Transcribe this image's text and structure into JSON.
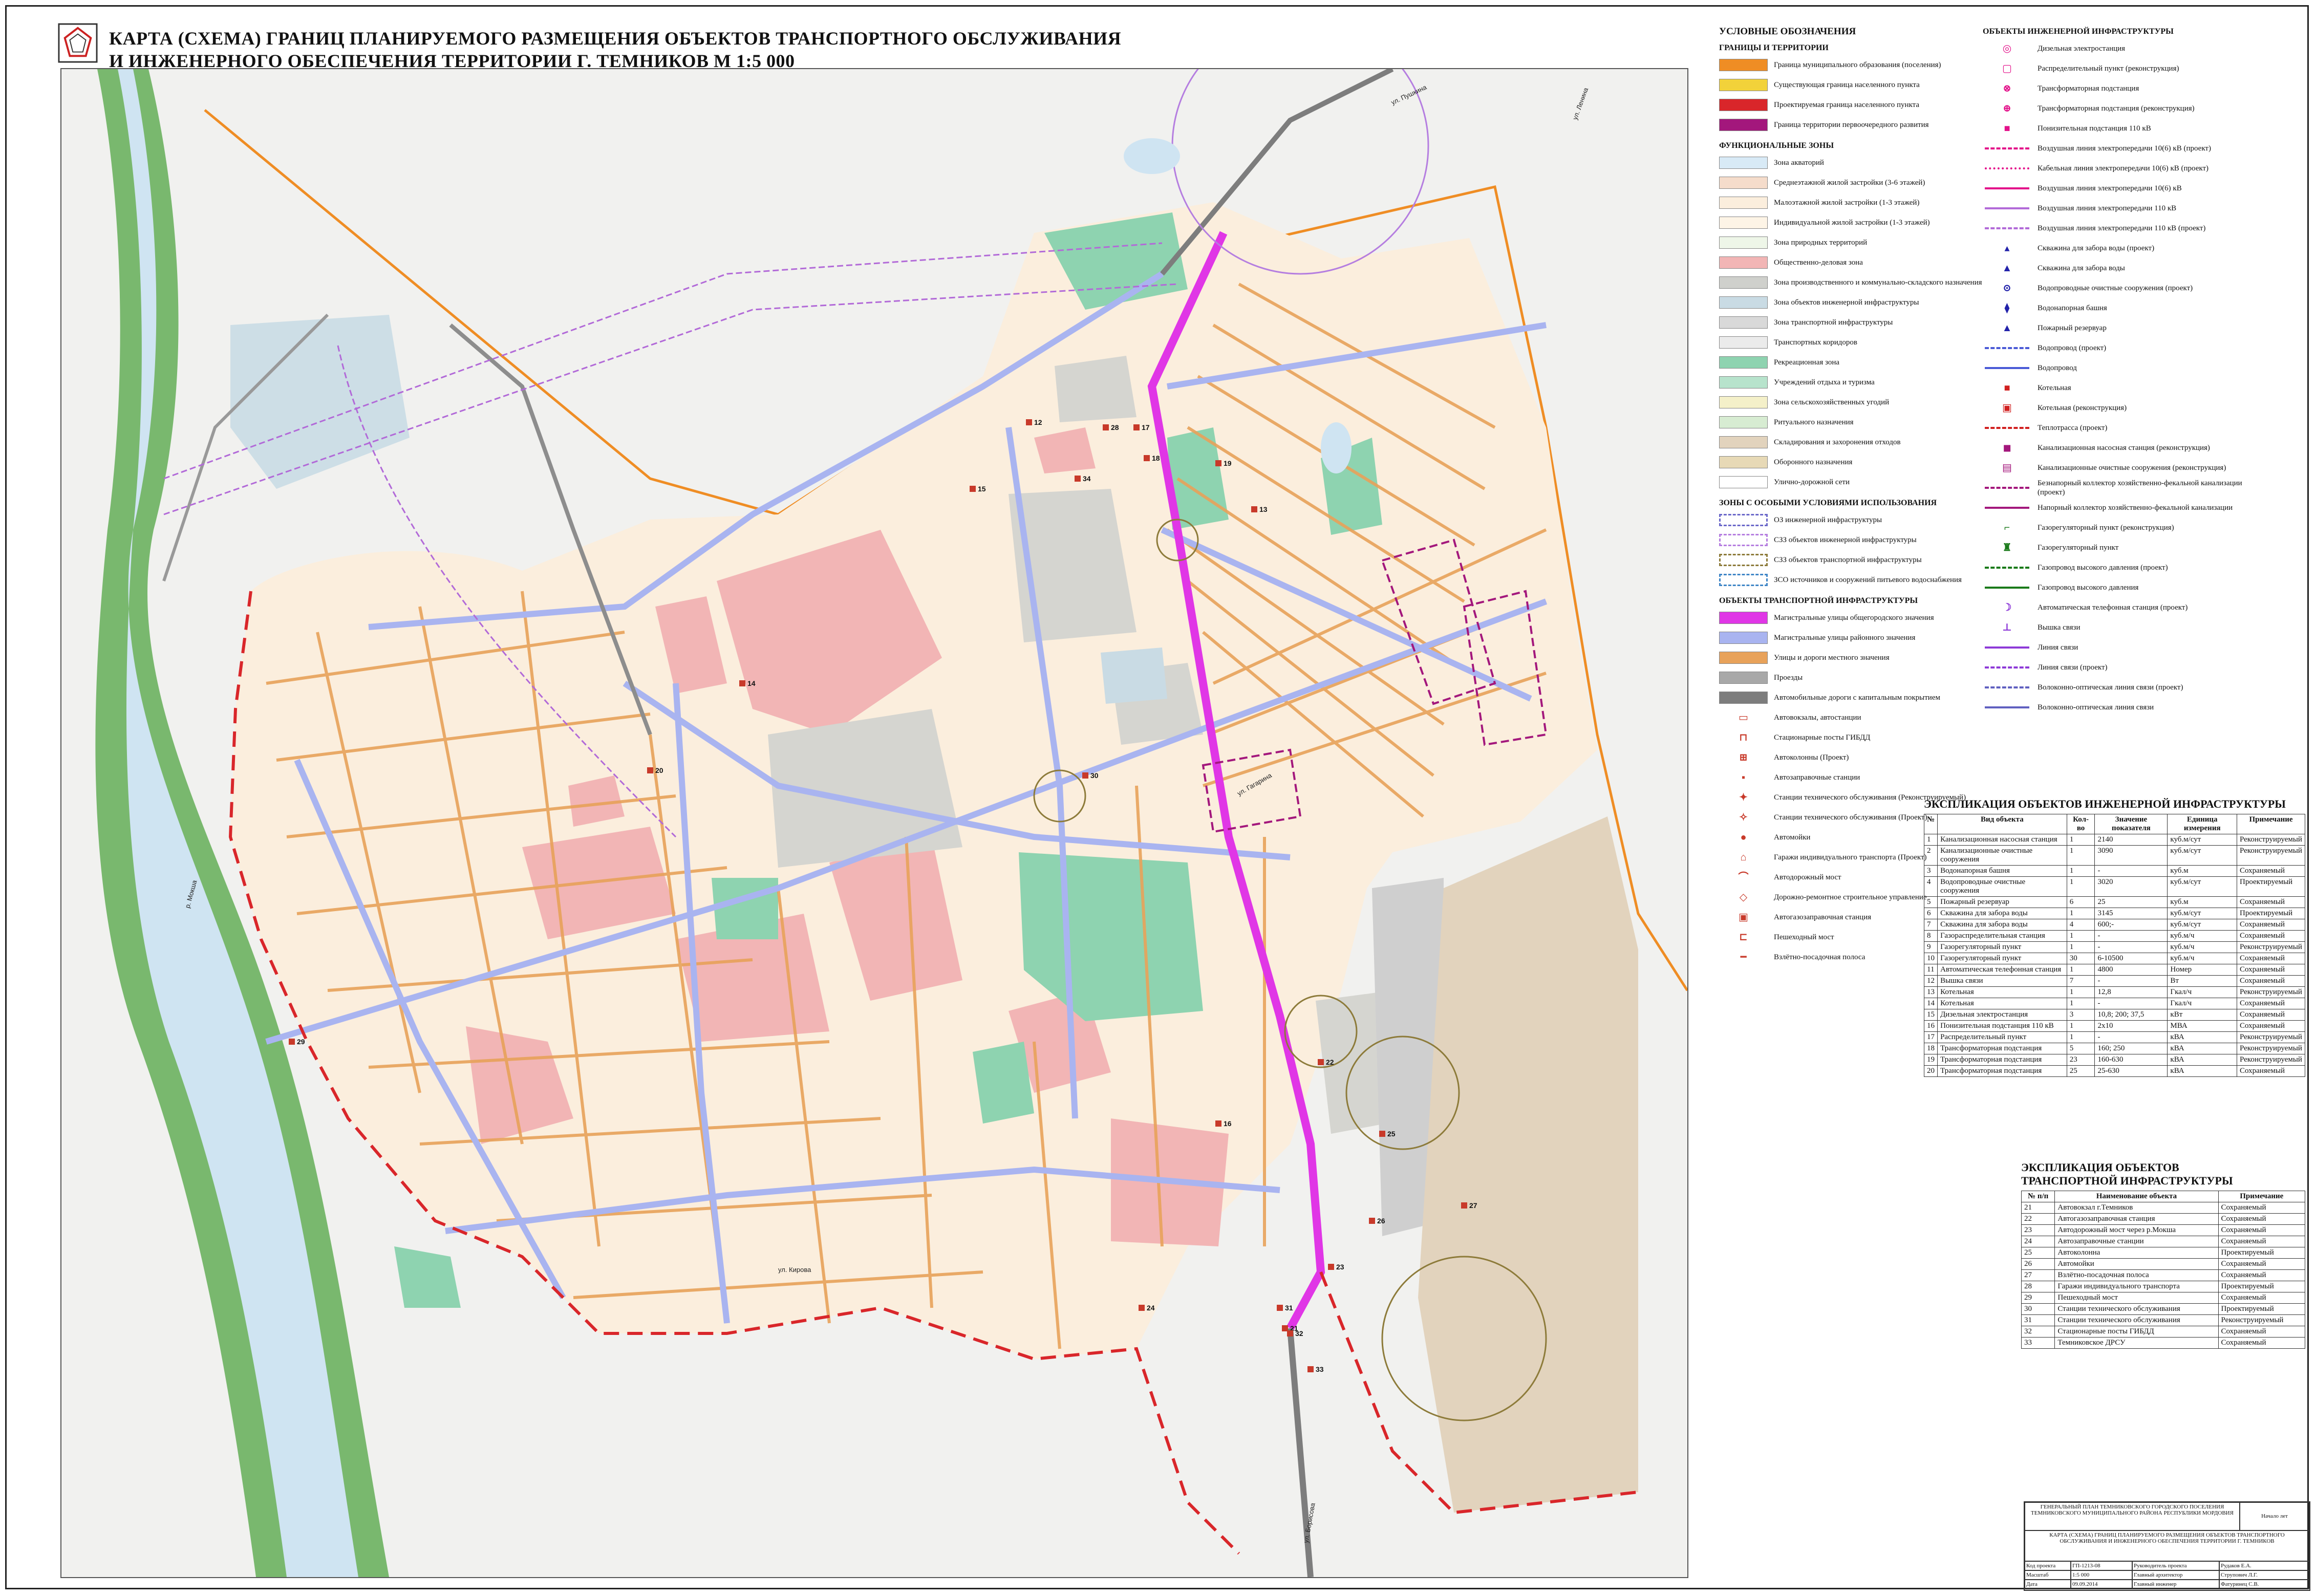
{
  "title": {
    "line1": "КАРТА (СХЕМА)  ГРАНИЦ ПЛАНИРУЕМОГО РАЗМЕЩЕНИЯ ОБЪЕКТОВ ТРАНСПОРТНОГО ОБСЛУЖИВАНИЯ",
    "line2": "И ИНЖЕНЕРНОГО ОБЕСПЕЧЕНИЯ ТЕРРИТОРИИ  Г. ТЕМНИКОВ   М 1:5 000"
  },
  "map": {
    "labels": {
      "river": "р. Мокша",
      "street_top": "ул. Пушкина",
      "street_right": "ул. Ленина",
      "street_bottom": "ул. Борисова",
      "street_btm2": "ул. Кирова",
      "street_mid": "ул. Гагарина"
    },
    "markers": [
      "12",
      "28",
      "17",
      "18",
      "34",
      "15",
      "19",
      "13",
      "22",
      "30",
      "25",
      "27",
      "26",
      "23",
      "21",
      "33",
      "24",
      "29",
      "14",
      "16",
      "20",
      "32",
      "31"
    ],
    "colors": {
      "residential_low": "#fbeedd",
      "residential_mid": "#f5e6dc",
      "public": "#f2b5b5",
      "green": "#8ed3b0",
      "industrial": "#d5d5d0",
      "transport": "#cfcfcf",
      "agri": "#e2d3bd",
      "natural": "#eef6e8",
      "water": "#cfe4f2",
      "water_bank": "#79b86e",
      "main_street": "#e036e6",
      "district_street": "#a9b4f0",
      "local_street": "#e8a25a",
      "boundary_design": "#d9262a",
      "boundary_muni": "#ef8d24"
    }
  },
  "legend": {
    "heading": "УСЛОВНЫЕ ОБОЗНАЧЕНИЯ",
    "boundaries": {
      "title": "ГРАНИЦЫ И ТЕРРИТОРИИ",
      "items": [
        {
          "label": "Граница муниципального образования (поселения)",
          "color": "#ef8d24",
          "kind": "fill"
        },
        {
          "label": "Существующая граница населенного пункта",
          "color": "#f2d23a",
          "kind": "fill"
        },
        {
          "label": "Проектируемая граница населенного пункта",
          "color": "#d9262a",
          "kind": "fill"
        },
        {
          "label": "Граница территории первоочередного развития",
          "color": "#a3177c",
          "kind": "fill"
        }
      ]
    },
    "zones": {
      "title": "ФУНКЦИОНАЛЬНЫЕ ЗОНЫ",
      "items": [
        {
          "label": "Зона акваторий",
          "color": "#d8eaf6"
        },
        {
          "label": "Среднеэтажной жилой застройки (3-6 этажей)",
          "color": "#f5dccb"
        },
        {
          "label": "Малоэтажной жилой застройки (1-3 этажей)",
          "color": "#fbeedd"
        },
        {
          "label": "Индивидуальной жилой застройки (1-3 этажей)",
          "color": "#fdf4e6"
        },
        {
          "label": "Зона природных территорий",
          "color": "#eef6e8"
        },
        {
          "label": "Общественно-деловая зона",
          "color": "#f2b5b5"
        },
        {
          "label": "Зона производственного и коммунально-складского назначения",
          "color": "#cfd0cc"
        },
        {
          "label": "Зона объектов инженерной инфраструктуры",
          "color": "#c9dbe4"
        },
        {
          "label": "Зона транспортной инфраструктуры",
          "color": "#d9d9d9"
        },
        {
          "label": "Транспортных коридоров",
          "color": "#ebebeb"
        },
        {
          "label": "Рекреационная зона",
          "color": "#8ed3b0"
        },
        {
          "label": "Учреждений отдыха и туризма",
          "color": "#b7e3cc"
        },
        {
          "label": "Зона сельскохозяйственных угодий",
          "color": "#f4f0c9"
        },
        {
          "label": "Ритуального назначения",
          "color": "#d7ecd2"
        },
        {
          "label": "Складирования и захоронения отходов",
          "color": "#e2d3bd"
        },
        {
          "label": "Оборонного назначения",
          "color": "#e7d9b6"
        },
        {
          "label": "Улично-дорожной сети",
          "color": "#ffffff"
        }
      ]
    },
    "special": {
      "title": "ЗОНЫ С ОСОБЫМИ УСЛОВИЯМИ ИСПОЛЬЗОВАНИЯ",
      "items": [
        {
          "label": "ОЗ инженерной инфраструктуры",
          "color": "#6b68c9"
        },
        {
          "label": "СЗЗ объектов инженерной инфраструктуры",
          "color": "#b57ee0"
        },
        {
          "label": "СЗЗ объектов транспортной инфраструктуры",
          "color": "#8d7b3a"
        },
        {
          "label": "ЗСО источников и сооружений питьевого водоснабжения",
          "color": "#3f86c7"
        }
      ]
    },
    "transport": {
      "title": "ОБЪЕКТЫ ТРАНСПОРТНОЙ ИНФРАСТРУКТУРЫ",
      "items": [
        {
          "label": "Магистральные улицы общегородского значения",
          "color": "#e036e6",
          "kind": "fill"
        },
        {
          "label": "Магистральные улицы районного значения",
          "color": "#a9b4f0",
          "kind": "fill"
        },
        {
          "label": "Улицы и дороги местного значения",
          "color": "#e8a25a",
          "kind": "fill"
        },
        {
          "label": "Проезды",
          "color": "#a8a8a8",
          "kind": "fill"
        },
        {
          "label": "Автомобильные дороги с капитальным покрытием",
          "color": "#7d7d7d",
          "kind": "fill"
        },
        {
          "label": "Автовокзалы, автостанции",
          "color": "#c83a2a",
          "kind": "sym",
          "glyph": "▭"
        },
        {
          "label": "Стационарные посты ГИБДД",
          "color": "#c83a2a",
          "kind": "sym",
          "glyph": "⊓"
        },
        {
          "label": "Автоколонны (Проект)",
          "color": "#c83a2a",
          "kind": "sym",
          "glyph": "⊞"
        },
        {
          "label": "Автозаправочные станции",
          "color": "#c83a2a",
          "kind": "sym",
          "glyph": "▪"
        },
        {
          "label": "Станции технического обслуживания (Реконструируемый)",
          "color": "#c83a2a",
          "kind": "sym",
          "glyph": "✦"
        },
        {
          "label": "Станции технического обслуживания (Проект)",
          "color": "#c83a2a",
          "kind": "sym",
          "glyph": "✧"
        },
        {
          "label": "Автомойки",
          "color": "#c83a2a",
          "kind": "sym",
          "glyph": "●"
        },
        {
          "label": "Гаражи индивидуального транспорта (Проект)",
          "color": "#c83a2a",
          "kind": "sym",
          "glyph": "⌂"
        },
        {
          "label": "Автодорожный мост",
          "color": "#c83a2a",
          "kind": "sym",
          "glyph": "⌒"
        },
        {
          "label": "Дорожно-ремонтное строительное управление",
          "color": "#c83a2a",
          "kind": "sym",
          "glyph": "◇"
        },
        {
          "label": "Автогазозаправочная станция",
          "color": "#c83a2a",
          "kind": "sym",
          "glyph": "▣"
        },
        {
          "label": "Пешеходный мост",
          "color": "#c83a2a",
          "kind": "sym",
          "glyph": "⊏"
        },
        {
          "label": "Взлётно-посадочная полоса",
          "color": "#c83a2a",
          "kind": "sym",
          "glyph": "━"
        }
      ]
    },
    "engineering": {
      "title": "ОБЪЕКТЫ ИНЖЕНЕРНОЙ ИНФРАСТРУКТУРЫ",
      "items": [
        {
          "label": "Дизельная электростанция",
          "color": "#e3118a",
          "kind": "sym",
          "glyph": "◎"
        },
        {
          "label": "Распределительный пункт (реконструкция)",
          "color": "#e3118a",
          "kind": "sym",
          "glyph": "▢"
        },
        {
          "label": "Трансформаторная подстанция",
          "color": "#e3118a",
          "kind": "sym",
          "glyph": "⊗"
        },
        {
          "label": "Трансформаторная подстанция (реконструкция)",
          "color": "#e3118a",
          "kind": "sym",
          "glyph": "⊕"
        },
        {
          "label": "Понизительная подстанция 110 кВ",
          "color": "#e3118a",
          "kind": "sym",
          "glyph": "■"
        },
        {
          "label": "Воздушная линия электропередачи 10(6) кВ (проект)",
          "color": "#e3118a",
          "kind": "dash"
        },
        {
          "label": "Кабельная линия электропередачи 10(6) кВ (проект)",
          "color": "#e3118a",
          "kind": "dot"
        },
        {
          "label": "Воздушная линия электропередачи 10(6) кВ",
          "color": "#e3118a",
          "kind": "line"
        },
        {
          "label": "Воздушная линия электропередачи 110 кВ",
          "color": "#b26ad8",
          "kind": "line"
        },
        {
          "label": "Воздушная линия электропередачи 110 кВ (проект)",
          "color": "#b26ad8",
          "kind": "dash"
        },
        {
          "label": "Скважина для забора воды (проект)",
          "color": "#2222aa",
          "kind": "sym",
          "glyph": "▴"
        },
        {
          "label": "Скважина для забора воды",
          "color": "#2222aa",
          "kind": "sym",
          "glyph": "▲"
        },
        {
          "label": "Водопроводные очистные сооружения (проект)",
          "color": "#2222aa",
          "kind": "sym",
          "glyph": "⊙"
        },
        {
          "label": "Водонапорная башня",
          "color": "#2222aa",
          "kind": "sym",
          "glyph": "⧫"
        },
        {
          "label": "Пожарный резервуар",
          "color": "#2222aa",
          "kind": "sym",
          "glyph": "▲"
        },
        {
          "label": "Водопровод (проект)",
          "color": "#4a5ad6",
          "kind": "dash"
        },
        {
          "label": "Водопровод",
          "color": "#4a5ad6",
          "kind": "line"
        },
        {
          "label": "Котельная",
          "color": "#d12020",
          "kind": "sym",
          "glyph": "■"
        },
        {
          "label": "Котельная  (реконструкция)",
          "color": "#d12020",
          "kind": "sym",
          "glyph": "▣"
        },
        {
          "label": "Теплотрасса  (проект)",
          "color": "#d12020",
          "kind": "dash"
        },
        {
          "label": "Канализационная насосная станция (реконструкция)",
          "color": "#a3177c",
          "kind": "sym",
          "glyph": "◼"
        },
        {
          "label": "Канализационные очистные сооружения (реконструкция)",
          "color": "#a3177c",
          "kind": "sym",
          "glyph": "▤"
        },
        {
          "label": "Безнапорный коллектор хозяйственно-фекальной канализации (проект)",
          "color": "#a3177c",
          "kind": "dash"
        },
        {
          "label": "Напорный коллектор хозяйственно-фекальной канализации",
          "color": "#a3177c",
          "kind": "line"
        },
        {
          "label": "Газорегуляторный пункт (реконструкция)",
          "color": "#1a7a1a",
          "kind": "sym",
          "glyph": "⌐"
        },
        {
          "label": "Газорегуляторный пункт",
          "color": "#1a7a1a",
          "kind": "sym",
          "glyph": "♜"
        },
        {
          "label": "Газопровод высокого давления (проект)",
          "color": "#1a7a1a",
          "kind": "dash"
        },
        {
          "label": "Газопровод высокого давления",
          "color": "#1a7a1a",
          "kind": "line"
        },
        {
          "label": "Автоматическая телефонная станция (проект)",
          "color": "#8d3ad8",
          "kind": "sym",
          "glyph": "☽"
        },
        {
          "label": "Вышка связи",
          "color": "#8d3ad8",
          "kind": "sym",
          "glyph": "⊥"
        },
        {
          "label": "Линия связи",
          "color": "#8d3ad8",
          "kind": "line"
        },
        {
          "label": "Линия связи (проект)",
          "color": "#8d3ad8",
          "kind": "dash"
        },
        {
          "label": "Волоконно-оптическая линия связи (проект)",
          "color": "#6060c0",
          "kind": "dash"
        },
        {
          "label": "Волоконно-оптическая линия связи",
          "color": "#6060c0",
          "kind": "line"
        }
      ]
    }
  },
  "eng_table": {
    "title": "ЭКСПЛИКАЦИЯ ОБЪЕКТОВ ИНЖЕНЕРНОЙ ИНФРАСТРУКТУРЫ",
    "headers": [
      "№",
      "Вид объекта",
      "Кол-во",
      "Значение показателя",
      "Единица измерения",
      "Примечание"
    ],
    "rows": [
      [
        "1",
        "Канализационная насосная станция",
        "1",
        "2140",
        "куб.м/сут",
        "Реконструируемый"
      ],
      [
        "2",
        "Канализационные очистные сооружения",
        "1",
        "3090",
        "куб.м/сут",
        "Реконструируемый"
      ],
      [
        "3",
        "Водонапорная башня",
        "1",
        "-",
        "куб.м",
        "Сохраняемый"
      ],
      [
        "4",
        "Водопроводные очистные сооружения",
        "1",
        "3020",
        "куб.м/сут",
        "Проектируемый"
      ],
      [
        "5",
        "Пожарный резервуар",
        "6",
        "25",
        "куб.м",
        "Сохраняемый"
      ],
      [
        "6",
        "Скважина для забора воды",
        "1",
        "3145",
        "куб.м/сут",
        "Проектируемый"
      ],
      [
        "7",
        "Скважина для забора воды",
        "4",
        "600;-",
        "куб.м/сут",
        "Сохраняемый"
      ],
      [
        "8",
        "Газораспределительная станция",
        "1",
        "-",
        "куб.м/ч",
        "Сохраняемый"
      ],
      [
        "9",
        "Газорегуляторный пункт",
        "1",
        "-",
        "куб.м/ч",
        "Реконструируемый"
      ],
      [
        "10",
        "Газорегуляторный пункт",
        "30",
        "6-10500",
        "куб.м/ч",
        "Сохраняемый"
      ],
      [
        "11",
        "Автоматическая телефонная станция",
        "1",
        "4800",
        "Номер",
        "Сохраняемый"
      ],
      [
        "12",
        "Вышка связи",
        "7",
        "-",
        "Вт",
        "Сохраняемый"
      ],
      [
        "13",
        "Котельная",
        "1",
        "12,8",
        "Гкал/ч",
        "Реконструируемый"
      ],
      [
        "14",
        "Котельная",
        "1",
        "-",
        "Гкал/ч",
        "Сохраняемый"
      ],
      [
        "15",
        "Дизельная электростанция",
        "3",
        "10,8; 200; 37,5",
        "кВт",
        "Сохраняемый"
      ],
      [
        "16",
        "Понизительная подстанция 110 кВ",
        "1",
        "2х10",
        "МВА",
        "Сохраняемый"
      ],
      [
        "17",
        "Распределительный пункт",
        "1",
        "-",
        "кВА",
        "Реконструируемый"
      ],
      [
        "18",
        "Трансформаторная подстанция",
        "5",
        "160; 250",
        "кВА",
        "Реконструируемый"
      ],
      [
        "19",
        "Трансформаторная подстанция",
        "23",
        "160-630",
        "кВА",
        "Реконструируемый"
      ],
      [
        "20",
        "Трансформаторная подстанция",
        "25",
        "25-630",
        "кВА",
        "Сохраняемый"
      ]
    ]
  },
  "tr_table": {
    "title_line1": "ЭКСПЛИКАЦИЯ ОБЪЕКТОВ",
    "title_line2": "ТРАНСПОРТНОЙ ИНФРАСТРУКТУРЫ",
    "headers": [
      "№ п/п",
      "Наименование объекта",
      "Примечание"
    ],
    "rows": [
      [
        "21",
        "Автовокзал г.Темников",
        "Сохраняемый"
      ],
      [
        "22",
        "Автогазозаправочная станция",
        "Сохраняемый"
      ],
      [
        "23",
        "Автодорожный мост через р.Мокша",
        "Сохраняемый"
      ],
      [
        "24",
        "Автозаправочные станции",
        "Сохраняемый"
      ],
      [
        "25",
        "Автоколонна",
        "Проектируемый"
      ],
      [
        "26",
        "Автомойки",
        "Сохраняемый"
      ],
      [
        "27",
        "Взлётно-посадочная полоса",
        "Сохраняемый"
      ],
      [
        "28",
        "Гаражи индивидуального транспорта",
        "Проектируемый"
      ],
      [
        "29",
        "Пешеходный мост",
        "Сохраняемый"
      ],
      [
        "30",
        "Станции технического обслуживания",
        "Проектируемый"
      ],
      [
        "31",
        "Станции технического обслуживания",
        "Реконструируемый"
      ],
      [
        "32",
        "Стационарные посты ГИБДД",
        "Сохраняемый"
      ],
      [
        "33",
        "Темниковское ДРСУ",
        "Сохраняемый"
      ]
    ]
  },
  "stamp": {
    "org": "ГЕНЕРАЛЬНЫЙ ПЛАН ТЕМНИКОВСКОГО ГОРОДСКОГО ПОСЕЛЕНИЯ ТЕМНИКОВСКОГО МУНИЦИПАЛЬНОГО РАЙОНА РЕСПУБЛИКИ МОРДОВИЯ",
    "sheets": "Начало лет",
    "sheet_title": "КАРТА (СХЕМА) ГРАНИЦ ПЛАНИРУЕМОГО РАЗМЕЩЕНИЯ ОБЪЕКТОВ ТРАНСПОРТНОГО ОБСЛУЖИВАНИЯ И ИНЖЕНЕРНОГО ОБЕСПЕЧЕНИЯ ТЕРРИТОРИИ Г. ТЕМНИКОВ",
    "rows": [
      [
        "Код проекта",
        "ГП-1213-08",
        "Руководитель проекта",
        "Рудаков Е.А."
      ],
      [
        "Масштаб",
        "1:5 000",
        "Главный архитектор",
        "Струпович Л.Г."
      ],
      [
        "Дата",
        "09.09.2014",
        "Главный инженер",
        "Фатуринец С.В."
      ]
    ],
    "sheet_no": "Лист",
    "sheet_val": "7"
  }
}
